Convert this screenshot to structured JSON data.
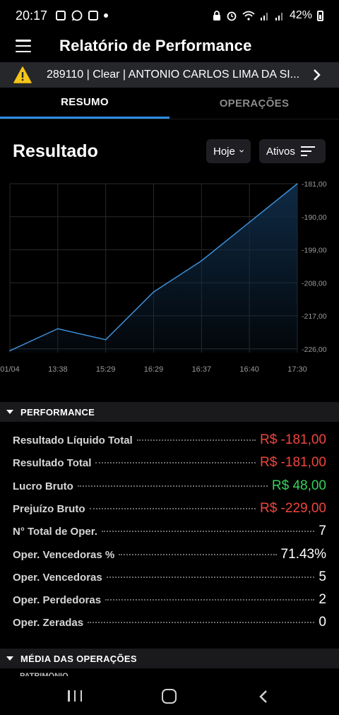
{
  "status_bar": {
    "time": "20:17",
    "battery": "42%",
    "icons": [
      "screenshot-icon",
      "whatsapp-icon",
      "screenshot-icon",
      "dot-icon",
      "lock-icon",
      "alarm-icon",
      "wifi-icon",
      "signal-icon",
      "signal-icon",
      "battery-icon"
    ]
  },
  "header": {
    "title": "Relatório de Performance",
    "menu_icon": "hamburger-menu-icon"
  },
  "account": {
    "text": "289110 | Clear | ANTONIO CARLOS LIMA DA SI...",
    "warning_icon": "warning-icon",
    "chevron_icon": "chevron-right-icon"
  },
  "tabs": [
    {
      "label": "RESUMO",
      "active": true
    },
    {
      "label": "OPERAÇÕES",
      "active": false
    }
  ],
  "result": {
    "title": "Resultado",
    "period_filter": "Hoje",
    "assets_filter": "Ativos"
  },
  "chart_data": {
    "type": "area",
    "categories": [
      "01/04",
      "13:38",
      "15:29",
      "16:29",
      "16:37",
      "16:40",
      "17:30"
    ],
    "values": [
      -226.5,
      -220.5,
      -223.5,
      -210.5,
      -202.0,
      -191.5,
      -181.0
    ],
    "y_tick_labels": [
      "-181,00",
      "-190,00",
      "-199,00",
      "-208,00",
      "-217,00",
      "-226,00"
    ],
    "y_ticks": [
      -181,
      -190,
      -199,
      -208,
      -217,
      -226
    ],
    "ylim": [
      -227,
      -181
    ],
    "grid": true,
    "line_color": "#3d8fd8",
    "fill_color": "#0f2a44"
  },
  "performance": {
    "section_label": "PERFORMANCE",
    "rows": [
      {
        "label": "Resultado Líquido Total",
        "value": "R$ -181,00",
        "tone": "neg"
      },
      {
        "label": "Resultado Total",
        "value": "R$ -181,00",
        "tone": "neg"
      },
      {
        "label": "Lucro Bruto",
        "value": "R$ 48,00",
        "tone": "pos"
      },
      {
        "label": "Prejuízo Bruto",
        "value": "R$ -229,00",
        "tone": "neg"
      },
      {
        "label": "N° Total de Oper.",
        "value": "7",
        "tone": "neu"
      },
      {
        "label": "Oper. Vencedoras %",
        "value": "71.43%",
        "tone": "neu"
      },
      {
        "label": "Oper. Vencedoras",
        "value": "5",
        "tone": "neu"
      },
      {
        "label": "Oper. Perdedoras",
        "value": "2",
        "tone": "neu"
      },
      {
        "label": "Oper. Zeradas",
        "value": "0",
        "tone": "neu"
      }
    ]
  },
  "media_section": {
    "section_label": "MÉDIA DAS OPERAÇÕES",
    "cut_label": "PATRIMÔNIO"
  },
  "colors": {
    "accent": "#2f8fe6",
    "negative": "#f0453d",
    "positive": "#34d35b",
    "banner": "#26272b",
    "warning": "#f5c518"
  }
}
